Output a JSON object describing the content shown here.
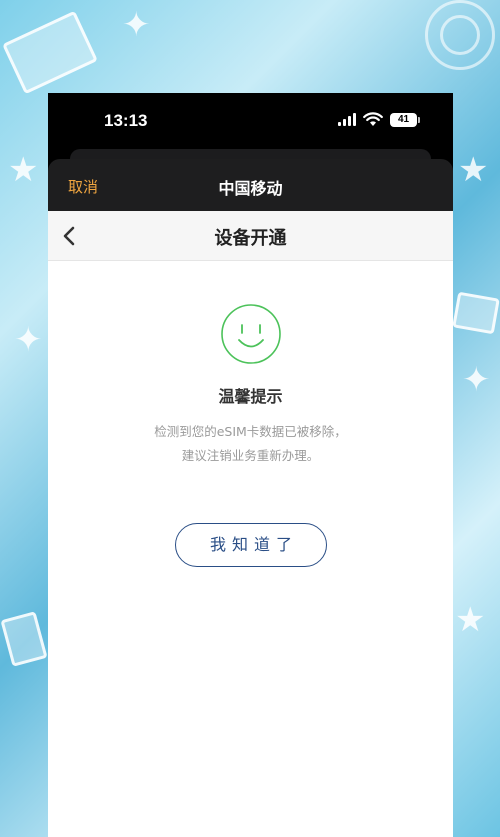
{
  "status_bar": {
    "time": "13:13",
    "battery": "41"
  },
  "sheet": {
    "cancel_label": "取消",
    "title": "中国移动"
  },
  "nav": {
    "title": "设备开通"
  },
  "content": {
    "tip_title": "温馨提示",
    "message_line1": "检测到您的eSIM卡数据已被移除，",
    "message_line2": "建议注销业务重新办理。",
    "ok_button_label": "我知道了"
  },
  "colors": {
    "accent_orange": "#f0a640",
    "button_blue": "#2a4e86",
    "smile_green": "#4cc25a"
  },
  "icons": {
    "back": "chevron-left-icon",
    "smile": "smile-icon",
    "signal": "signal-icon",
    "wifi": "wifi-icon",
    "battery": "battery-icon"
  }
}
